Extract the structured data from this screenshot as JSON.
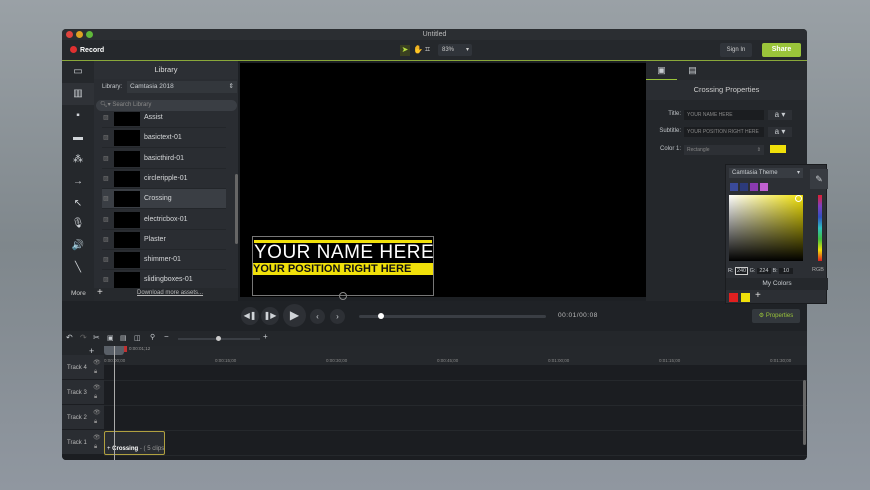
{
  "window": {
    "title": "Untitled"
  },
  "toolbar": {
    "record_label": "Record",
    "zoom": "83%",
    "sign_in": "Sign In",
    "share": "Share"
  },
  "rail": {
    "icons": [
      "media-icon",
      "library-icon",
      "annotations-icon",
      "transitions-icon",
      "behaviors-icon",
      "animations-icon",
      "cursor-effects-icon",
      "voice-narration-icon",
      "audio-effects-icon",
      "visual-effects-icon"
    ],
    "more": "More"
  },
  "library": {
    "header": "Library",
    "library_label": "Library:",
    "library_value": "Camtasia 2018",
    "search_placeholder": "Search Library",
    "items": [
      "Assist",
      "basictext-01",
      "basicthird-01",
      "circleripple-01",
      "Crossing",
      "electricbox-01",
      "Plaster",
      "shimmer-01",
      "slidingboxes-01"
    ],
    "selected": "Crossing",
    "download": "Download more assets..."
  },
  "canvas": {
    "title_text": "YOUR NAME HERE",
    "subtitle_text": "YOUR POSITION RIGHT HERE"
  },
  "properties": {
    "header": "Crossing Properties",
    "title_label": "Title:",
    "title_value": "YOUR NAME HERE",
    "subtitle_label": "Subtitle:",
    "subtitle_value": "YOUR POSITION RIGHT HERE",
    "color1_label": "Color 1:",
    "color1_value": "Rectangle",
    "font_glyph": "a",
    "button": "Properties"
  },
  "picker": {
    "theme": "Camtasia Theme",
    "r_label": "R:",
    "r": "240",
    "g_label": "G:",
    "g": "224",
    "b_label": "B:",
    "b": "10",
    "mode": "RGB",
    "my_colors": "My Colors",
    "theme_swatches": [
      "#3a4a9a",
      "#2c3a7a",
      "#8a3ab0",
      "#c060d0"
    ],
    "my_swatches": [
      "#e02020",
      "#f0e00a"
    ]
  },
  "playback": {
    "time": "00:01/00:08",
    "progress": 0.12
  },
  "timeline": {
    "playhead_time": "0:00:01;12",
    "ticks": [
      "0:00:00;00",
      "0:00:15;00",
      "0:00:30;00",
      "0:00:45;00",
      "0:01:00;00",
      "0:01:15;00",
      "0:01:30;00"
    ],
    "tracks": [
      "Track 4",
      "Track 3",
      "Track 2",
      "Track 1"
    ],
    "clip_name": "Crossing",
    "clip_info": "- ( 5 clips"
  },
  "colors": {
    "accent": "#9ac43a",
    "highlight": "#f0e00a",
    "record": "#e03030"
  }
}
